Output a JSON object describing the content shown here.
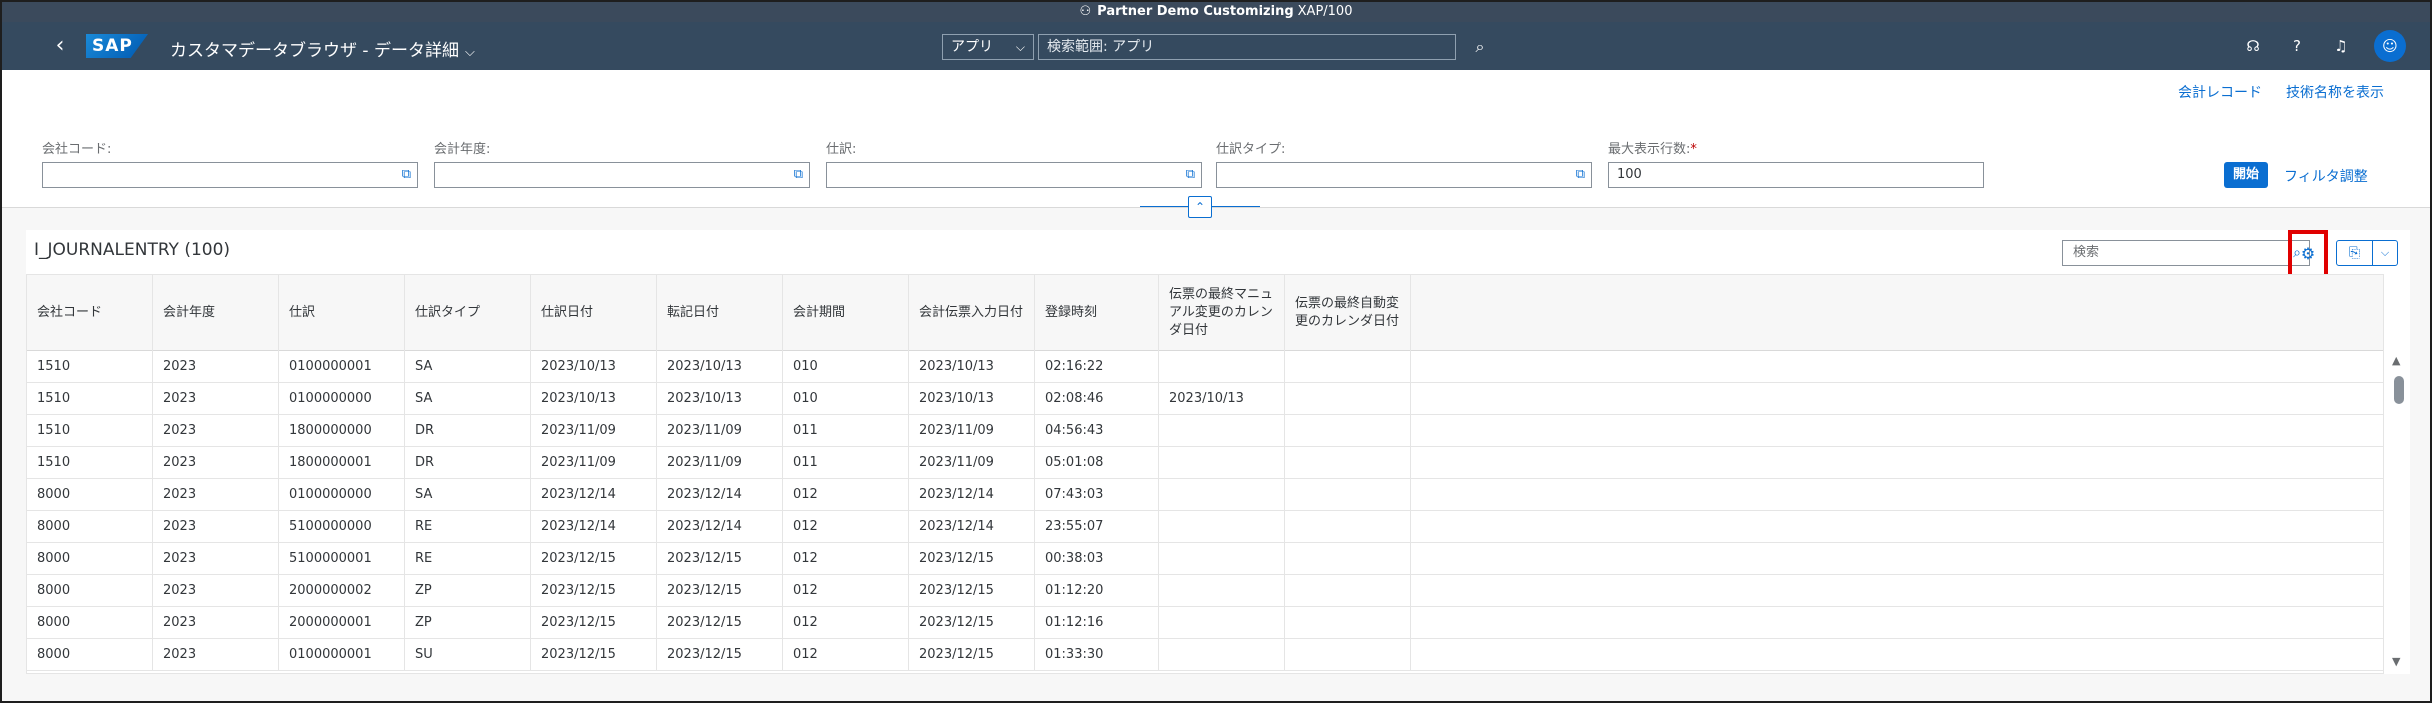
{
  "system": {
    "title": "Partner Demo Customizing",
    "client": "XAP/100"
  },
  "shell": {
    "back_label": "‹",
    "logo": "SAP",
    "app_title": "カスタマデータブラウザ - データ詳細",
    "search_scope": "アプリ",
    "search_placeholder": "検索範囲: アプリ",
    "icons": [
      "search-icon",
      "help-icon",
      "question-icon",
      "bell-icon",
      "user-avatar-icon"
    ]
  },
  "header": {
    "links": [
      "会計レコード",
      "技術名称を表示"
    ],
    "filters": [
      {
        "label": "会社コード:",
        "value": "",
        "required": false
      },
      {
        "label": "会計年度:",
        "value": "",
        "required": false
      },
      {
        "label": "仕訳:",
        "value": "",
        "required": false
      },
      {
        "label": "仕訳タイプ:",
        "value": "",
        "required": false
      },
      {
        "label": "最大表示行数:",
        "value": "100",
        "required": true
      }
    ],
    "go_label": "開始",
    "adapt_label": "フィルタ調整"
  },
  "table": {
    "title": "I_JOURNALENTRY (100)",
    "search_placeholder": "検索",
    "columns": [
      "会社コード",
      "会計年度",
      "仕訳",
      "仕訳タイプ",
      "仕訳日付",
      "転記日付",
      "会計期間",
      "会計伝票入力日付",
      "登録時刻",
      "伝票の最終マニュアル変更のカレンダ日付",
      "伝票の最終自動変更のカレンダ日付"
    ],
    "rows": [
      [
        "1510",
        "2023",
        "0100000001",
        "SA",
        "2023/10/13",
        "2023/10/13",
        "010",
        "2023/10/13",
        "02:16:22",
        "",
        ""
      ],
      [
        "1510",
        "2023",
        "0100000000",
        "SA",
        "2023/10/13",
        "2023/10/13",
        "010",
        "2023/10/13",
        "02:08:46",
        "2023/10/13",
        ""
      ],
      [
        "1510",
        "2023",
        "1800000000",
        "DR",
        "2023/11/09",
        "2023/11/09",
        "011",
        "2023/11/09",
        "04:56:43",
        "",
        ""
      ],
      [
        "1510",
        "2023",
        "1800000001",
        "DR",
        "2023/11/09",
        "2023/11/09",
        "011",
        "2023/11/09",
        "05:01:08",
        "",
        ""
      ],
      [
        "8000",
        "2023",
        "0100000000",
        "SA",
        "2023/12/14",
        "2023/12/14",
        "012",
        "2023/12/14",
        "07:43:03",
        "",
        ""
      ],
      [
        "8000",
        "2023",
        "5100000000",
        "RE",
        "2023/12/14",
        "2023/12/14",
        "012",
        "2023/12/14",
        "23:55:07",
        "",
        ""
      ],
      [
        "8000",
        "2023",
        "5100000001",
        "RE",
        "2023/12/15",
        "2023/12/15",
        "012",
        "2023/12/15",
        "00:38:03",
        "",
        ""
      ],
      [
        "8000",
        "2023",
        "2000000002",
        "ZP",
        "2023/12/15",
        "2023/12/15",
        "012",
        "2023/12/15",
        "01:12:20",
        "",
        ""
      ],
      [
        "8000",
        "2023",
        "2000000001",
        "ZP",
        "2023/12/15",
        "2023/12/15",
        "012",
        "2023/12/15",
        "01:12:16",
        "",
        ""
      ],
      [
        "8000",
        "2023",
        "0100000001",
        "SU",
        "2023/12/15",
        "2023/12/15",
        "012",
        "2023/12/15",
        "01:33:30",
        "",
        ""
      ]
    ]
  }
}
